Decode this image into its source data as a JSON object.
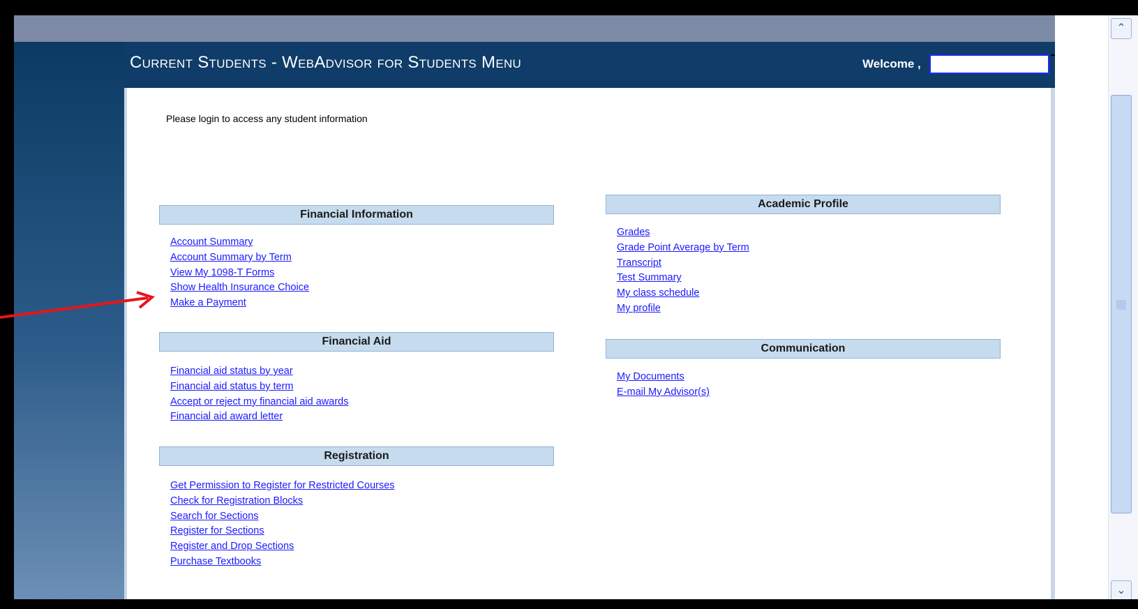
{
  "header": {
    "title": "Current Students - WebAdvisor for Students Menu",
    "welcome_label": "Welcome ,"
  },
  "login_message": "Please login to access any student information",
  "sections": {
    "financial_information": {
      "heading": "Financial Information",
      "links": [
        "Account Summary",
        "Account Summary by Term",
        "View My 1098-T Forms",
        "Show Health Insurance Choice",
        "Make a Payment"
      ]
    },
    "financial_aid": {
      "heading": "Financial Aid",
      "links": [
        "Financial aid status by year",
        "Financial aid status by term",
        "Accept or reject my financial aid awards",
        "Financial aid award letter"
      ]
    },
    "registration": {
      "heading": "Registration",
      "links": [
        "Get Permission to Register for Restricted Courses",
        "Check for Registration Blocks",
        "Search for Sections",
        "Register for Sections",
        "Register and Drop Sections",
        "Purchase Textbooks"
      ]
    },
    "academic_profile": {
      "heading": "Academic Profile",
      "links": [
        "Grades",
        "Grade Point Average by Term",
        "Transcript",
        "Test Summary",
        "My class schedule",
        "My profile"
      ]
    },
    "communication": {
      "heading": "Communication",
      "links": [
        "My Documents",
        "E-mail My Advisor(s)"
      ]
    }
  },
  "scrollbar": {
    "up_icon": "chevron-up-icon",
    "down_icon": "chevron-down-icon"
  },
  "annotation": {
    "arrow_color": "#e8141b"
  },
  "colors": {
    "header_bg": "#0f3c68",
    "section_bg": "#c6dbee",
    "link": "#1a1aff"
  }
}
